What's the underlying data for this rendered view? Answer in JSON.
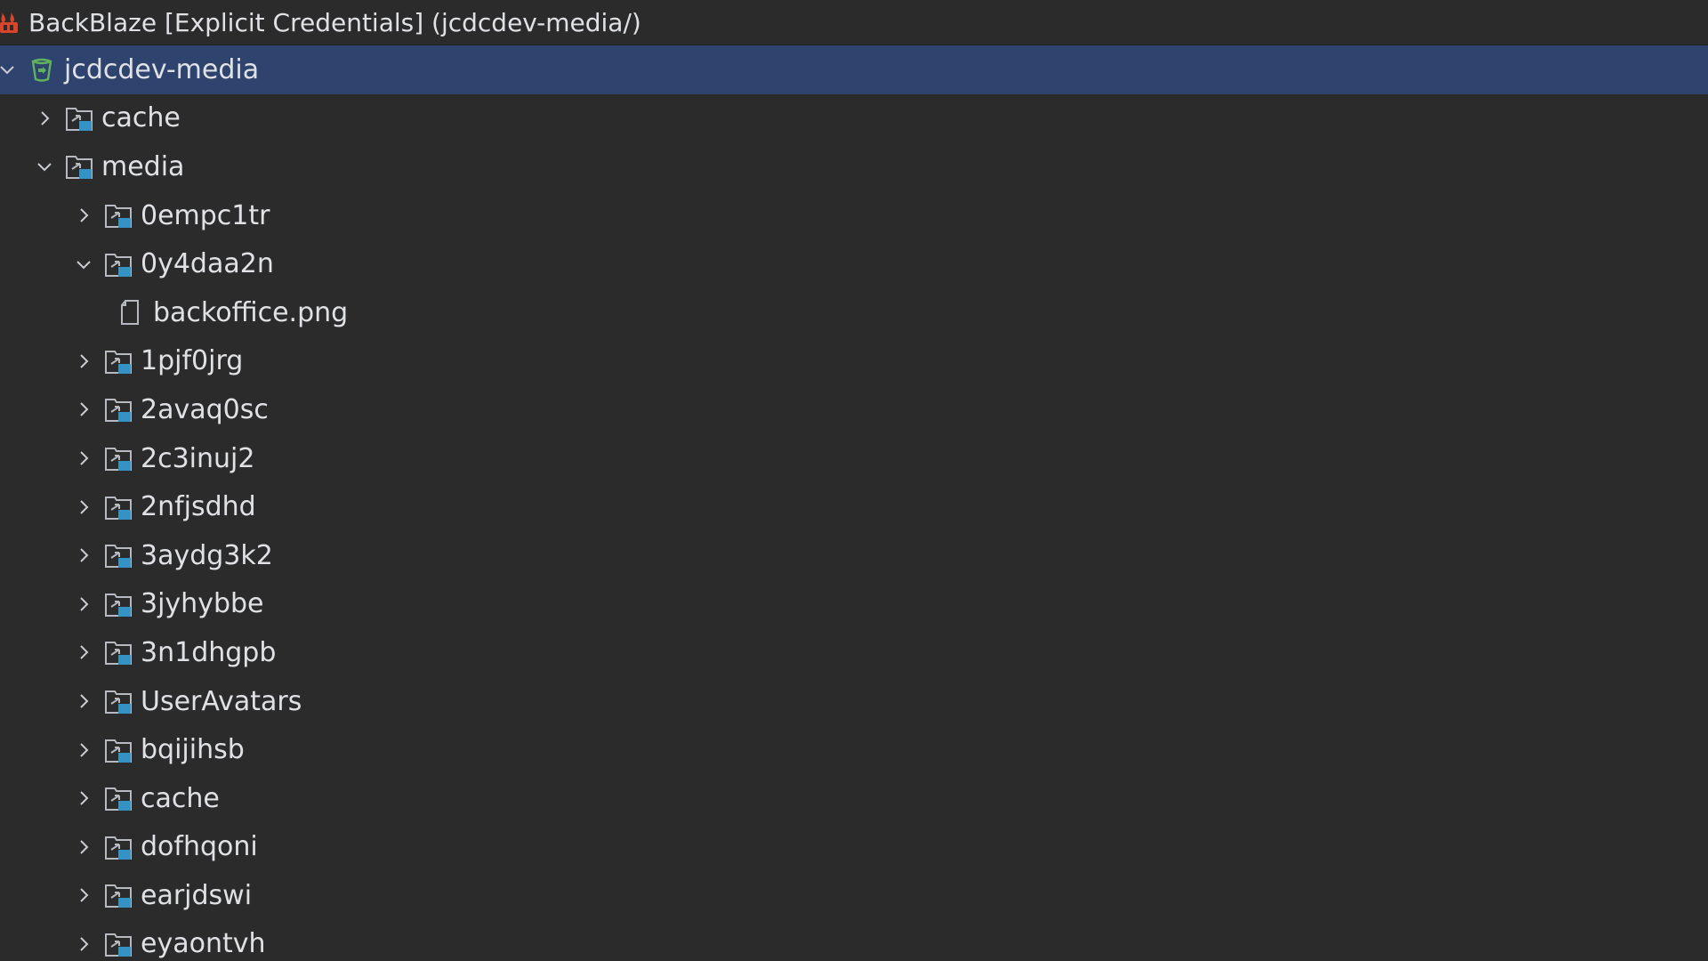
{
  "title_bar": {
    "text": "BackBlaze [Explicit Credentials] (jcdcdev-media/)",
    "icon": "backblaze-logo-icon",
    "icon_color": "#d9452b"
  },
  "colors": {
    "background": "#2b2b2b",
    "selected_row": "#2e436e",
    "text": "#dfe1e5",
    "bucket_icon": "#5fb25f",
    "folder_accent": "#3592c4"
  },
  "tree": {
    "bucket": {
      "label": "jcdcdev-media",
      "expanded": true,
      "icon": "bucket-icon"
    },
    "cache_root": {
      "label": "cache",
      "expanded": false,
      "icon": "folder-icon"
    },
    "media": {
      "label": "media",
      "expanded": true,
      "icon": "folder-icon"
    },
    "media_children": [
      {
        "label": "0empc1tr",
        "expanded": false,
        "icon": "folder-icon"
      },
      {
        "label": "0y4daa2n",
        "expanded": true,
        "icon": "folder-icon"
      },
      {
        "label": "backoffice.png",
        "icon": "file-icon"
      },
      {
        "label": "1pjf0jrg",
        "expanded": false,
        "icon": "folder-icon"
      },
      {
        "label": "2avaq0sc",
        "expanded": false,
        "icon": "folder-icon"
      },
      {
        "label": "2c3inuj2",
        "expanded": false,
        "icon": "folder-icon"
      },
      {
        "label": "2nfjsdhd",
        "expanded": false,
        "icon": "folder-icon"
      },
      {
        "label": "3aydg3k2",
        "expanded": false,
        "icon": "folder-icon"
      },
      {
        "label": "3jyhybbe",
        "expanded": false,
        "icon": "folder-icon"
      },
      {
        "label": "3n1dhgpb",
        "expanded": false,
        "icon": "folder-icon"
      },
      {
        "label": "UserAvatars",
        "expanded": false,
        "icon": "folder-icon"
      },
      {
        "label": "bqijihsb",
        "expanded": false,
        "icon": "folder-icon"
      },
      {
        "label": "cache",
        "expanded": false,
        "icon": "folder-icon"
      },
      {
        "label": "dofhqoni",
        "expanded": false,
        "icon": "folder-icon"
      },
      {
        "label": "earjdswi",
        "expanded": false,
        "icon": "folder-icon"
      },
      {
        "label": "eyaontvh",
        "expanded": false,
        "icon": "folder-icon"
      }
    ]
  }
}
